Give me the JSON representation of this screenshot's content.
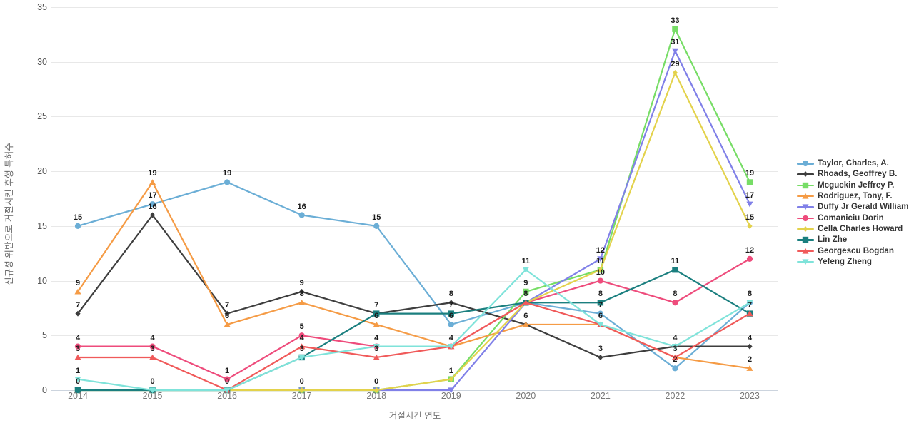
{
  "chart_data": {
    "type": "line",
    "title": "",
    "xlabel": "거절시킨 연도",
    "ylabel": "신규성 위반으로 거절시킨 후행 특허수",
    "categories": [
      "2014",
      "2015",
      "2016",
      "2017",
      "2018",
      "2019",
      "2020",
      "2021",
      "2022",
      "2023"
    ],
    "x": [
      2014,
      2015,
      2016,
      2017,
      2018,
      2019,
      2020,
      2021,
      2022,
      2023
    ],
    "ylim": [
      0,
      35
    ],
    "yticks": [
      0,
      5,
      10,
      15,
      20,
      25,
      30,
      35
    ],
    "grid": true,
    "legend_position": "right",
    "show_point_labels": true,
    "series": [
      {
        "name": "Taylor, Charles, A.",
        "color": "#6BAED6",
        "marker": "circle",
        "values": [
          15,
          17,
          19,
          16,
          15,
          6,
          8,
          7,
          2,
          8
        ]
      },
      {
        "name": "Rhoads, Geoffrey B.",
        "color": "#3E3E3E",
        "marker": "diamond",
        "values": [
          7,
          16,
          7,
          9,
          7,
          8,
          6,
          3,
          4,
          4
        ]
      },
      {
        "name": "Mcguckin Jeffrey P.",
        "color": "#77DD66",
        "marker": "square",
        "values": [
          0,
          0,
          0,
          0,
          0,
          1,
          9,
          11,
          33,
          19
        ]
      },
      {
        "name": "Rodriguez, Tony, F.",
        "color": "#F59B45",
        "marker": "triangle-up",
        "values": [
          9,
          19,
          6,
          8,
          6,
          4,
          6,
          6,
          3,
          2
        ]
      },
      {
        "name": "Duffy Jr Gerald William",
        "color": "#8080E8",
        "marker": "triangle-down",
        "values": [
          0,
          0,
          0,
          0,
          0,
          0,
          8,
          12,
          31,
          17
        ]
      },
      {
        "name": "Comaniciu Dorin",
        "color": "#EE4C7C",
        "marker": "circle",
        "values": [
          4,
          4,
          1,
          5,
          4,
          4,
          8,
          10,
          8,
          12
        ]
      },
      {
        "name": "Cella Charles Howard",
        "color": "#E3D24B",
        "marker": "diamond",
        "values": [
          0,
          0,
          0,
          0,
          0,
          1,
          8,
          11,
          29,
          15
        ]
      },
      {
        "name": "Lin Zhe",
        "color": "#1B7F7F",
        "marker": "square",
        "values": [
          0,
          0,
          0,
          3,
          7,
          7,
          8,
          8,
          11,
          7
        ]
      },
      {
        "name": "Georgescu Bogdan",
        "color": "#F05A5A",
        "marker": "triangle-up",
        "values": [
          3,
          3,
          0,
          4,
          3,
          4,
          8,
          6,
          3,
          7
        ]
      },
      {
        "name": "Yefeng Zheng",
        "color": "#7FE3DA",
        "marker": "triangle-down",
        "values": [
          1,
          0,
          0,
          3,
          4,
          4,
          11,
          6,
          4,
          8
        ]
      }
    ],
    "point_labels": [
      {
        "x": 2014,
        "y": 15,
        "text": "15"
      },
      {
        "x": 2014,
        "y": 9,
        "text": "9"
      },
      {
        "x": 2014,
        "y": 7,
        "text": "7"
      },
      {
        "x": 2014,
        "y": 4,
        "text": "4"
      },
      {
        "x": 2014,
        "y": 3,
        "text": "3"
      },
      {
        "x": 2014,
        "y": 1,
        "text": "1"
      },
      {
        "x": 2014,
        "y": 0,
        "text": "0"
      },
      {
        "x": 2015,
        "y": 19,
        "text": "19"
      },
      {
        "x": 2015,
        "y": 17,
        "text": "17"
      },
      {
        "x": 2015,
        "y": 16,
        "text": "16"
      },
      {
        "x": 2015,
        "y": 4,
        "text": "4"
      },
      {
        "x": 2015,
        "y": 3,
        "text": "3"
      },
      {
        "x": 2015,
        "y": 0,
        "text": "0"
      },
      {
        "x": 2016,
        "y": 19,
        "text": "19"
      },
      {
        "x": 2016,
        "y": 7,
        "text": "7"
      },
      {
        "x": 2016,
        "y": 6,
        "text": "6"
      },
      {
        "x": 2016,
        "y": 1,
        "text": "1"
      },
      {
        "x": 2016,
        "y": 0,
        "text": "0"
      },
      {
        "x": 2017,
        "y": 16,
        "text": "16"
      },
      {
        "x": 2017,
        "y": 9,
        "text": "9"
      },
      {
        "x": 2017,
        "y": 8,
        "text": "8"
      },
      {
        "x": 2017,
        "y": 5,
        "text": "5"
      },
      {
        "x": 2017,
        "y": 4,
        "text": "4"
      },
      {
        "x": 2017,
        "y": 3,
        "text": "3"
      },
      {
        "x": 2017,
        "y": 0,
        "text": "0"
      },
      {
        "x": 2018,
        "y": 15,
        "text": "15"
      },
      {
        "x": 2018,
        "y": 7,
        "text": "7"
      },
      {
        "x": 2018,
        "y": 6,
        "text": "6"
      },
      {
        "x": 2018,
        "y": 4,
        "text": "4"
      },
      {
        "x": 2018,
        "y": 3,
        "text": "3"
      },
      {
        "x": 2018,
        "y": 0,
        "text": "0"
      },
      {
        "x": 2019,
        "y": 8,
        "text": "8"
      },
      {
        "x": 2019,
        "y": 7,
        "text": "7"
      },
      {
        "x": 2019,
        "y": 6,
        "text": "6"
      },
      {
        "x": 2019,
        "y": 4,
        "text": "4"
      },
      {
        "x": 2019,
        "y": 1,
        "text": "1"
      },
      {
        "x": 2020,
        "y": 11,
        "text": "11"
      },
      {
        "x": 2020,
        "y": 9,
        "text": "9"
      },
      {
        "x": 2020,
        "y": 8,
        "text": "8"
      },
      {
        "x": 2020,
        "y": 6,
        "text": "6"
      },
      {
        "x": 2021,
        "y": 12,
        "text": "12"
      },
      {
        "x": 2021,
        "y": 11,
        "text": "11"
      },
      {
        "x": 2021,
        "y": 10,
        "text": "10"
      },
      {
        "x": 2021,
        "y": 8,
        "text": "8"
      },
      {
        "x": 2021,
        "y": 7,
        "text": "7"
      },
      {
        "x": 2021,
        "y": 6,
        "text": "6"
      },
      {
        "x": 2021,
        "y": 3,
        "text": "3"
      },
      {
        "x": 2022,
        "y": 33,
        "text": "33"
      },
      {
        "x": 2022,
        "y": 31,
        "text": "31"
      },
      {
        "x": 2022,
        "y": 29,
        "text": "29"
      },
      {
        "x": 2022,
        "y": 11,
        "text": "11"
      },
      {
        "x": 2022,
        "y": 8,
        "text": "8"
      },
      {
        "x": 2022,
        "y": 4,
        "text": "4"
      },
      {
        "x": 2022,
        "y": 3,
        "text": "3"
      },
      {
        "x": 2022,
        "y": 2,
        "text": "2"
      },
      {
        "x": 2023,
        "y": 19,
        "text": "19"
      },
      {
        "x": 2023,
        "y": 17,
        "text": "17"
      },
      {
        "x": 2023,
        "y": 15,
        "text": "15"
      },
      {
        "x": 2023,
        "y": 12,
        "text": "12"
      },
      {
        "x": 2023,
        "y": 8,
        "text": "8"
      },
      {
        "x": 2023,
        "y": 7,
        "text": "7"
      },
      {
        "x": 2023,
        "y": 4,
        "text": "4"
      },
      {
        "x": 2023,
        "y": 2,
        "text": "2"
      }
    ]
  }
}
